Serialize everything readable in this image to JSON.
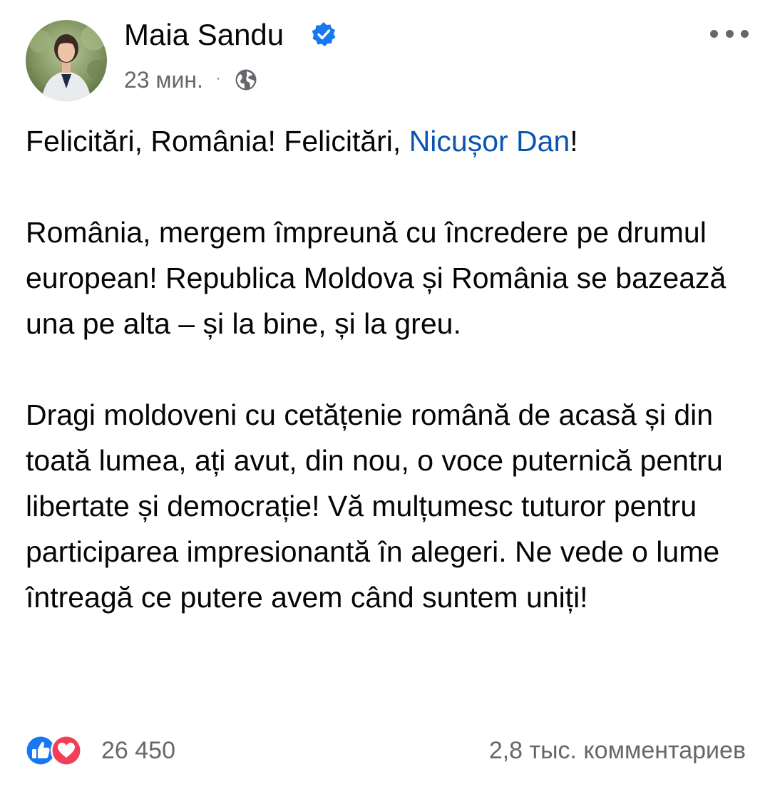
{
  "post": {
    "author": {
      "name": "Maia Sandu",
      "verified": true,
      "avatar": "profile-photo"
    },
    "time": "23 мин.",
    "separator": "·",
    "audience_icon": "globe-icon",
    "more_icon": "more-options-icon",
    "text": {
      "p1_before": "Felicitări, România! Felicitări, ",
      "p1_mention": "Nicușor Dan",
      "p1_after": "!",
      "p2": "România, mergem împreună cu încredere pe drumul european! Republica Moldova și România se bazează una pe alta – și la bine, și la greu.",
      "p3": "Dragi moldoveni cu cetățenie română de acasă și din toată lumea, ați avut, din nou, o voce puternică pentru libertate și democrație! Vă mulțumesc tuturor pentru participarea impresionantă în alegeri. Ne vede o lume întreagă ce putere avem când suntem uniți!"
    },
    "reactions": {
      "icons": [
        "like-icon",
        "love-icon"
      ],
      "count": "26 450"
    },
    "comments": "2,8 тыс. комментариев"
  },
  "colors": {
    "mention": "#0a54b2",
    "secondary_text": "#65676b",
    "verified": "#1877f2",
    "like": "#1877f2",
    "love": "#f33e58"
  }
}
